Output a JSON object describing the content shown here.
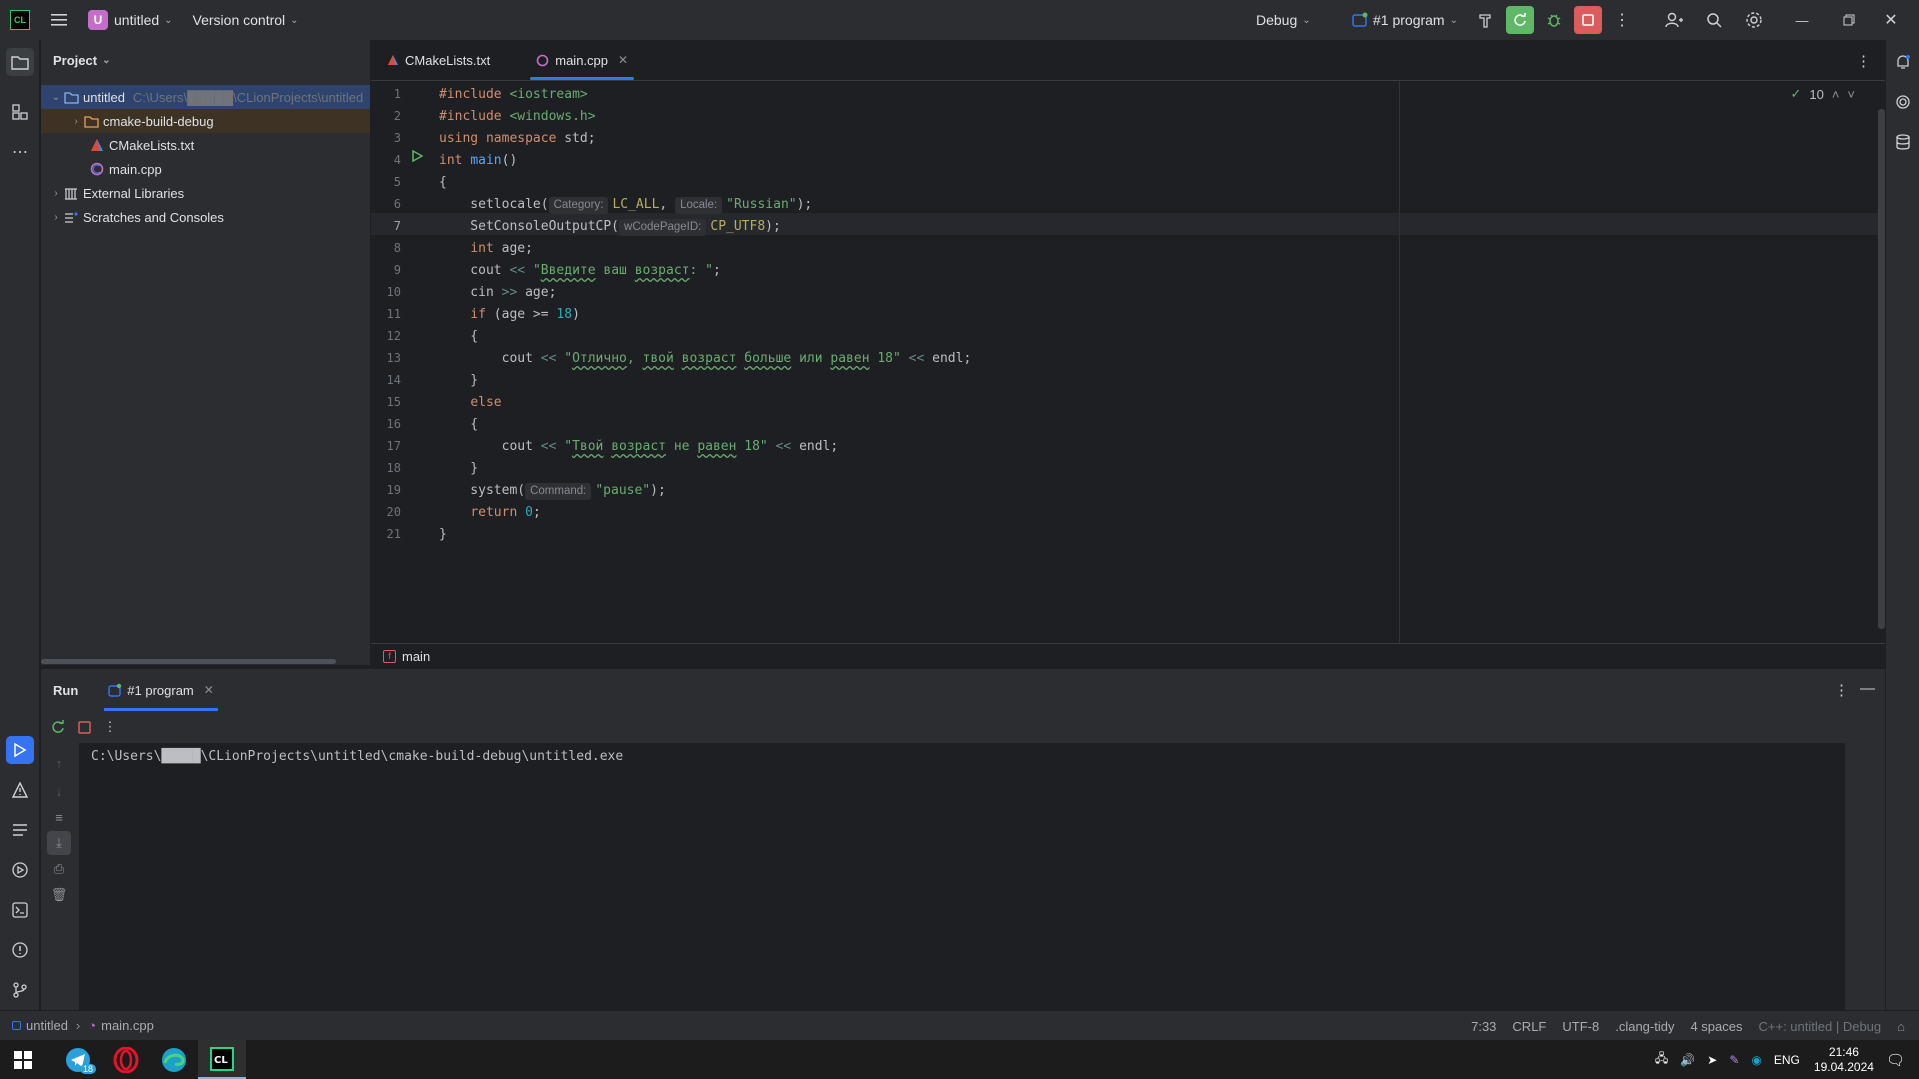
{
  "titlebar": {
    "project_badge": "U",
    "project_name": "untitled",
    "vcs": "Version control",
    "config": "Debug",
    "run_config": "#1 program"
  },
  "project_panel": {
    "title": "Project",
    "tree": [
      {
        "label": "untitled",
        "hint": "C:\\Users\\█████\\CLionProjects\\untitled",
        "icon": "folder-icon",
        "expanded": true
      },
      {
        "label": "cmake-build-debug",
        "icon": "folder-icon",
        "expanded": false
      },
      {
        "label": "CMakeLists.txt",
        "icon": "cmake-icon"
      },
      {
        "label": "main.cpp",
        "icon": "cpp-file-icon"
      },
      {
        "label": "External Libraries",
        "icon": "library-icon",
        "expanded": false
      },
      {
        "label": "Scratches and Consoles",
        "icon": "scratches-icon",
        "expanded": false
      }
    ]
  },
  "editor": {
    "tabs": [
      {
        "label": "CMakeLists.txt",
        "active": false
      },
      {
        "label": "main.cpp",
        "active": true
      }
    ],
    "inspection_count": "10",
    "line_numbers": [
      "1",
      "2",
      "3",
      "4",
      "5",
      "6",
      "7",
      "8",
      "9",
      "10",
      "11",
      "12",
      "13",
      "14",
      "15",
      "16",
      "17",
      "18",
      "19",
      "20",
      "21"
    ],
    "current_line": 7,
    "hints": {
      "category": "Category:",
      "locale": "Locale:",
      "codepage": "wCodePageID:",
      "command": "Command:"
    },
    "breadcrumb": "main"
  },
  "run_panel": {
    "title": "Run",
    "tab": "#1 program",
    "console_output": "C:\\Users\\█████\\CLionProjects\\untitled\\cmake-build-debug\\untitled.exe"
  },
  "statusbar": {
    "project": "untitled",
    "file": "main.cpp",
    "position": "7:33",
    "line_ending": "CRLF",
    "encoding": "UTF-8",
    "linter": ".clang-tidy",
    "indent": "4 spaces",
    "context": "C++: untitled | Debug"
  },
  "taskbar": {
    "telegram_badge": "18",
    "lang": "ENG",
    "time": "21:46",
    "date": "19.04.2024"
  },
  "colors": {
    "accent": "#3574f0",
    "run_green": "#5fb865",
    "stop_red": "#db5c5c",
    "project_badge": "#c56ec9"
  }
}
